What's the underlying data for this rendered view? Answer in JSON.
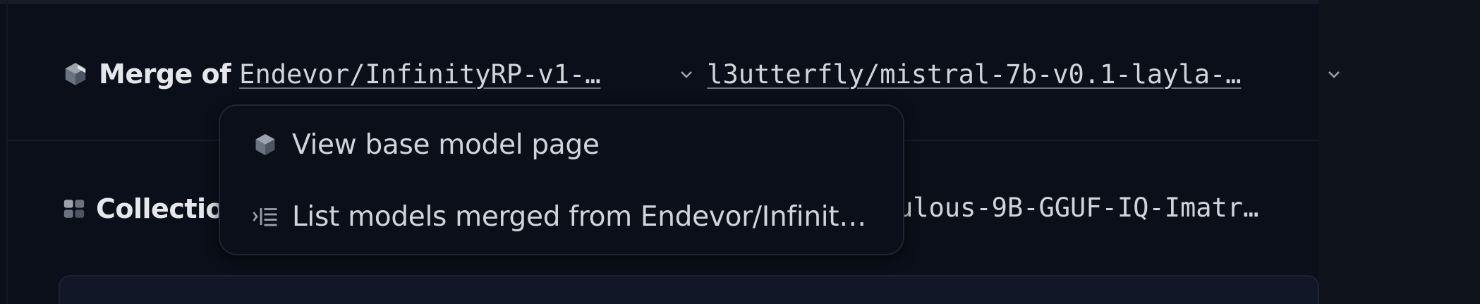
{
  "merge": {
    "label": "Merge of",
    "model_a": "Endevor/InfinityRP-v1-…",
    "model_b": "l3utterfly/mistral-7b-v0.1-layla-…"
  },
  "collections": {
    "label": "Collectio",
    "tail": "ulous-9B-GGUF-IQ-Imatr…"
  },
  "menu": {
    "items": [
      {
        "label": "View base model page",
        "icon": "cube-icon"
      },
      {
        "label": "List models merged from Endevor/Infinit…",
        "icon": "list-indent-icon"
      }
    ]
  }
}
